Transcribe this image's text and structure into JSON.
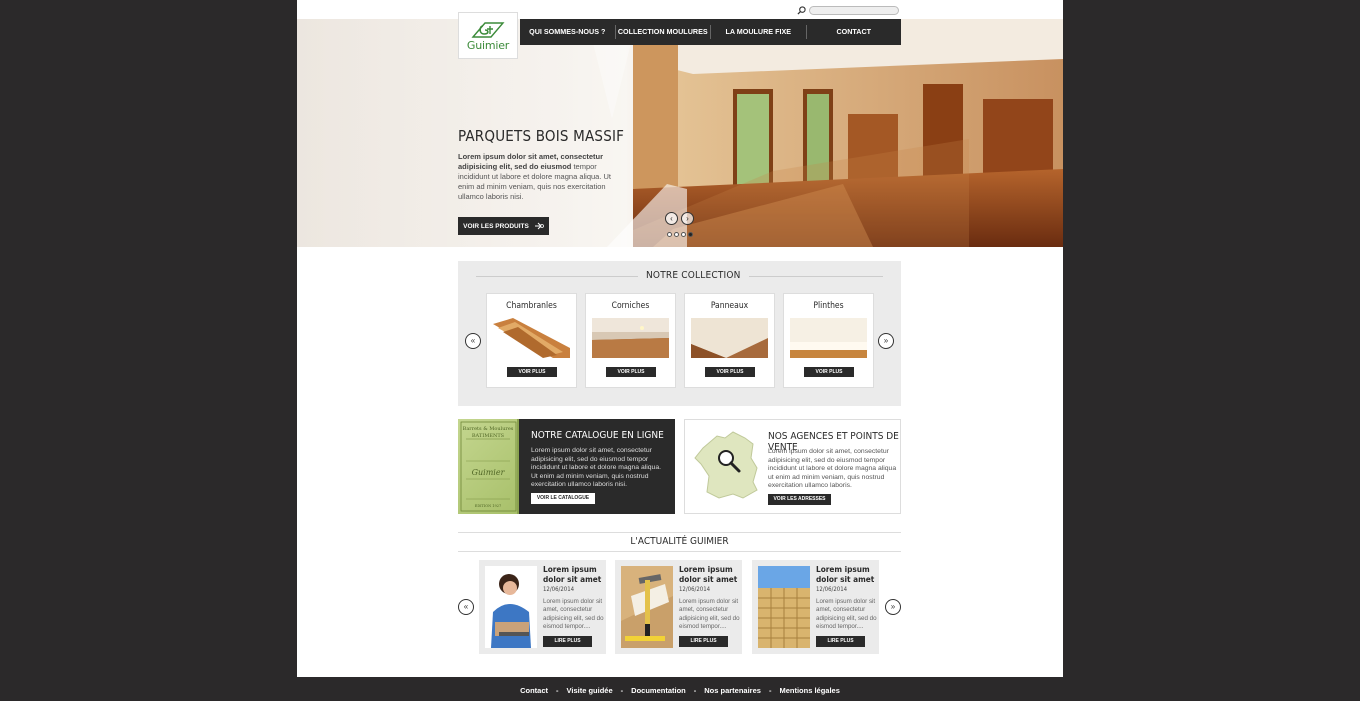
{
  "header": {
    "logo_text": "Guimier",
    "search": {
      "placeholder": ""
    },
    "nav": [
      "QUI SOMMES-NOUS ?",
      "COLLECTION MOULURES",
      "LA MOULURE FIXE",
      "CONTACT"
    ]
  },
  "hero": {
    "title": "PARQUETS BOIS MASSIF",
    "text_bold": "Lorem ipsum dolor sit amet, consectetur adipisicing elit, sed do eiusmod",
    "text_rest": " tempor incididunt ut labore et dolore magna aliqua. Ut enim ad minim veniam, quis nos exercitation ullamco laboris nisi.",
    "button": "VOIR LES PRODUITS",
    "slides": 4,
    "active_slide": 4
  },
  "collection": {
    "title": "NOTRE COLLECTION",
    "items": [
      {
        "name": "Chambranles",
        "button": "VOIR PLUS"
      },
      {
        "name": "Corniches",
        "button": "VOIR PLUS"
      },
      {
        "name": "Panneaux",
        "button": "VOIR PLUS"
      },
      {
        "name": "Plinthes",
        "button": "VOIR PLUS"
      }
    ]
  },
  "catalog": {
    "title": "NOTRE CATALOGUE EN LIGNE",
    "text": "Lorem ipsum dolor sit amet, consectetur adipisicing elit, sed do eiusmod tempor incididunt ut labore et dolore magna aliqua. Ut enim ad minim veniam, quis nostrud exercitation ullamco laboris nisi.",
    "button": "VOIR LE CATALOGUE",
    "book_lines": [
      "Barrets & Moulures",
      "BATIMENTS",
      "Guimier",
      "EDITION 1927"
    ]
  },
  "agencies": {
    "title": "NOS AGENCES ET POINTS DE VENTE",
    "text": "Lorem ipsum dolor sit amet, consectetur adipisicing elit, sed do eiusmod tempor incididunt ut labore et dolore magna aliqua ut enim ad minim veniam, quis nostrud exercitation ullamco laboris.",
    "button": "VOIR LES ADRESSES"
  },
  "news": {
    "title": "L'ACTUALITÉ GUIMIER",
    "items": [
      {
        "title": "Lorem ipsum dolor sit amet",
        "date": "12/06/2014",
        "text": "Lorem ipsum dolor sit amet, consectetur adipisicing elit, sed do eismod tempor....",
        "button": "LIRE PLUS"
      },
      {
        "title": "Lorem ipsum dolor sit amet",
        "date": "12/06/2014",
        "text": "Lorem ipsum dolor sit amet, consectetur adipisicing elit, sed do eismod tempor....",
        "button": "LIRE PLUS"
      },
      {
        "title": "Lorem ipsum dolor sit amet",
        "date": "12/06/2014",
        "text": "Lorem ipsum dolor sit amet, consectetur adipisicing elit, sed do eismod tempor....",
        "button": "LIRE PLUS"
      }
    ]
  },
  "footer": {
    "links": [
      "Contact",
      "Visite guidée",
      "Documentation",
      "Nos partenaires",
      "Mentions légales"
    ],
    "separator": "-"
  },
  "colors": {
    "dark": "#2a2a2a",
    "brand_green": "#3c8b3a",
    "panel_grey": "#ebebeb",
    "background": "#2b292a"
  }
}
